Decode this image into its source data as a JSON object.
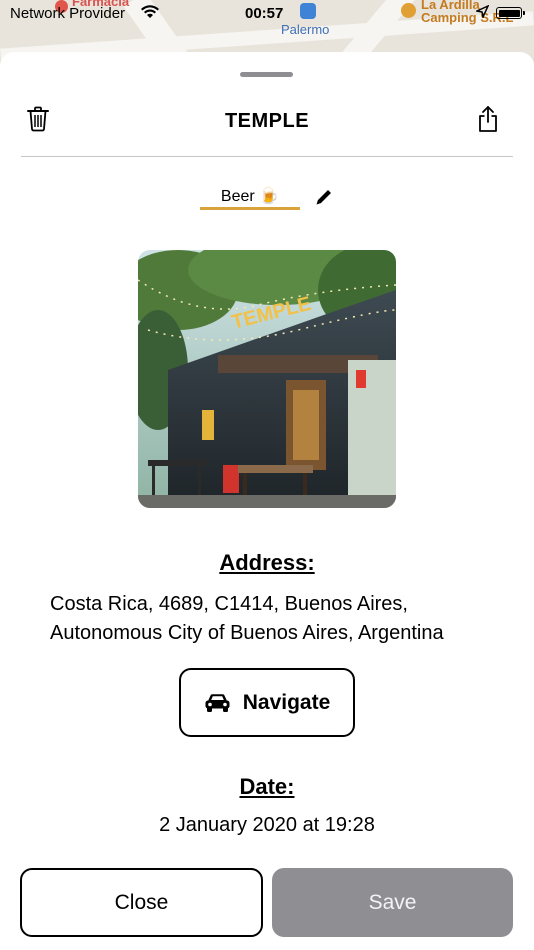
{
  "status_bar": {
    "carrier": "Network Provider",
    "time": "00:57"
  },
  "map": {
    "labels": [
      "Farmacia",
      "Palermo",
      "La Ardilla",
      "Camping S.R.L"
    ]
  },
  "header": {
    "title": "TEMPLE",
    "delete_icon": "trash-icon",
    "share_icon": "share-icon"
  },
  "category": {
    "label": "Beer 🍺",
    "accent_color": "#d9a23b",
    "edit_icon": "pencil-icon"
  },
  "photo": {
    "sign_text": "TEMPLE"
  },
  "address": {
    "heading": "Address:",
    "line1": "Costa Rica, 4689, C1414, Buenos Aires,",
    "line2": "Autonomous City of Buenos Aires, Argentina"
  },
  "navigate": {
    "label": "Navigate",
    "icon": "car-icon"
  },
  "date": {
    "heading": "Date:",
    "value": "2 January 2020 at 19:28"
  },
  "actions": {
    "close_label": "Close",
    "save_label": "Save",
    "save_color": "#8e8e93"
  }
}
